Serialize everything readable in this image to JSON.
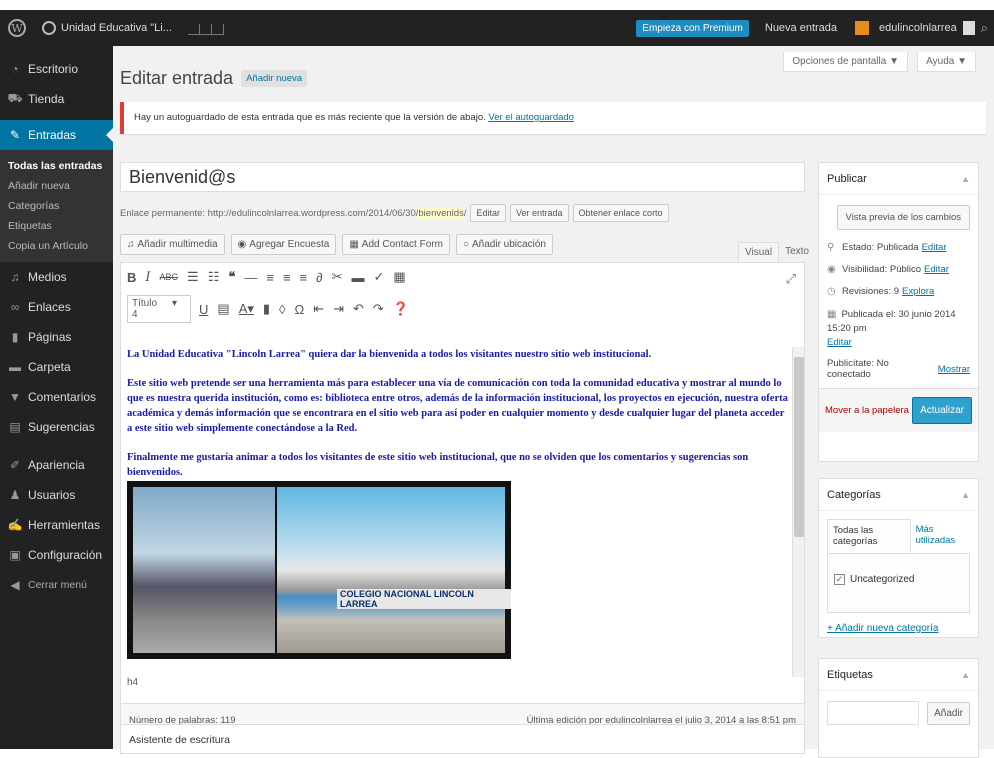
{
  "adminbar": {
    "site_name": "Unidad Educativa \"Li...",
    "premium": "Empieza con Premium",
    "new_post": "Nueva entrada",
    "user": "edulincolnlarrea"
  },
  "sidebar": {
    "items": [
      {
        "label": "Escritorio",
        "icon": "dashboard-icon"
      },
      {
        "label": "Tienda",
        "icon": "cart-icon"
      },
      {
        "label": "Entradas",
        "icon": "pin-icon"
      },
      {
        "label": "Medios",
        "icon": "media-icon"
      },
      {
        "label": "Enlaces",
        "icon": "link-icon"
      },
      {
        "label": "Páginas",
        "icon": "pages-icon"
      },
      {
        "label": "Carpeta",
        "icon": "folder-icon"
      },
      {
        "label": "Comentarios",
        "icon": "comment-icon"
      },
      {
        "label": "Sugerencias",
        "icon": "feedback-icon"
      },
      {
        "label": "Apariencia",
        "icon": "brush-icon"
      },
      {
        "label": "Usuarios",
        "icon": "users-icon"
      },
      {
        "label": "Herramientas",
        "icon": "wrench-icon"
      },
      {
        "label": "Configuración",
        "icon": "settings-icon"
      },
      {
        "label": "Cerrar menú",
        "icon": "collapse-icon"
      }
    ],
    "submenu": [
      "Todas las entradas",
      "Añadir nueva",
      "Categorías",
      "Etiquetas",
      "Copia un Artículo"
    ]
  },
  "header": {
    "title": "Editar entrada",
    "add_new": "Añadir nueva",
    "screen_options": "Opciones de pantalla ▼",
    "help": "Ayuda ▼"
  },
  "notice": {
    "text": "Hay un autoguardado de esta entrada que es más reciente que la versión de abajo.",
    "link": "Ver el autoguardado"
  },
  "post": {
    "title": "Bienvenid@s",
    "permalink_label": "Enlace permanente:",
    "permalink_base": "http://edulincolnlarrea.wordpress.com/2014/06/30/",
    "permalink_slug": "bienvenids",
    "permalink_end": "/",
    "btn_edit": "Editar",
    "btn_view": "Ver entrada",
    "btn_shortlink": "Obtener enlace corto"
  },
  "media_buttons": [
    "Añadir multimedia",
    "Agregar Encuesta",
    "Add Contact Form",
    "Añadir ubicación"
  ],
  "editor_tabs": {
    "visual": "Visual",
    "text": "Texto"
  },
  "format_select": "Título 4",
  "content": {
    "p1": "La Unidad Educativa \"Lincoln Larrea\" quiera dar la bienvenida a todos los visitantes  nuestro sitio web institucional.",
    "p2": "Este sitio web pretende ser una herramienta más para establecer una vía de comunicación con toda la comunidad educativa y mostrar al mundo lo que es nuestra querida institución, como es: biblioteca entre otros, además de la información institucional, los proyectos en ejecución, nuestra oferta académica y demás información que se encontrara en el sitio web para así poder en cualquier momento y desde cualquier lugar del planeta acceder a este sitio web simplemente conectándose a la Red.",
    "p3": "Finalmente me gustaría animar a todos los visitantes de este sitio web institucional, que no se olviden que los comentarios y sugerencias son bienvenidos.",
    "photo_sign": "COLEGIO NACIONAL LINCOLN LARREA"
  },
  "editor_path": "h4",
  "word_count": "Número de palabras: 119",
  "last_edit": "Última edición por edulincolnlarrea el julio 3, 2014 a las 8:51 pm",
  "writing_helper": "Asistente de escritura",
  "publish": {
    "title": "Publicar",
    "preview": "Vista previa de los cambios",
    "status_label": "Estado: Publicada",
    "status_link": "Editar",
    "visibility_label": "Visibilidad: Público",
    "visibility_link": "Editar",
    "revisions_label": "Revisiones: 9",
    "revisions_link": "Explora",
    "published_label": "Publicada el: 30 junio 2014 15:20 pm",
    "published_link": "Editar",
    "publicize_label": "Publicítate: No conectado",
    "publicize_link": "Mostrar",
    "trash": "Mover a la papelera",
    "update": "Actualizar"
  },
  "categories": {
    "title": "Categorías",
    "tab_all": "Todas las categorías",
    "tab_popular": "Más utilizadas",
    "item": "Uncategorized",
    "add": "+ Añadir nueva categoría"
  },
  "tags": {
    "title": "Etiquetas",
    "add_btn": "Añadir"
  }
}
